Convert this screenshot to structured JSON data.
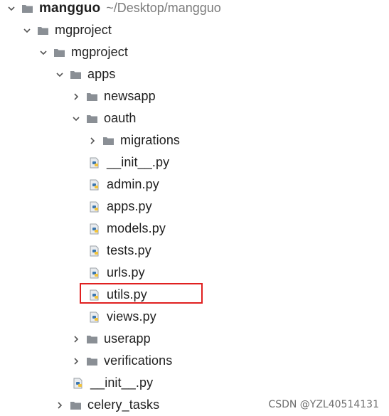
{
  "tree": {
    "root": {
      "label": "mangguo",
      "path": "~/Desktop/mangguo"
    },
    "mgproject_outer": "mgproject",
    "mgproject_inner": "mgproject",
    "apps": "apps",
    "newsapp": "newsapp",
    "oauth": "oauth",
    "migrations": "migrations",
    "oauth_files": [
      "__init__.py",
      "admin.py",
      "apps.py",
      "models.py",
      "tests.py",
      "urls.py",
      "utils.py",
      "views.py"
    ],
    "userapp": "userapp",
    "verifications": "verifications",
    "apps_init": "__init__.py",
    "celery_tasks": "celery_tasks"
  },
  "highlighted_file": "utils.py",
  "watermark": "CSDN @YZL40514131",
  "colors": {
    "folder": "#8a8f95",
    "highlight": "#e02020",
    "python_blue": "#3b77b0",
    "python_yellow": "#f2c33b"
  },
  "icons": {
    "folder": "folder-icon",
    "python_file": "python-file-icon",
    "expanded": "chevron-down-icon",
    "collapsed": "chevron-right-icon"
  }
}
